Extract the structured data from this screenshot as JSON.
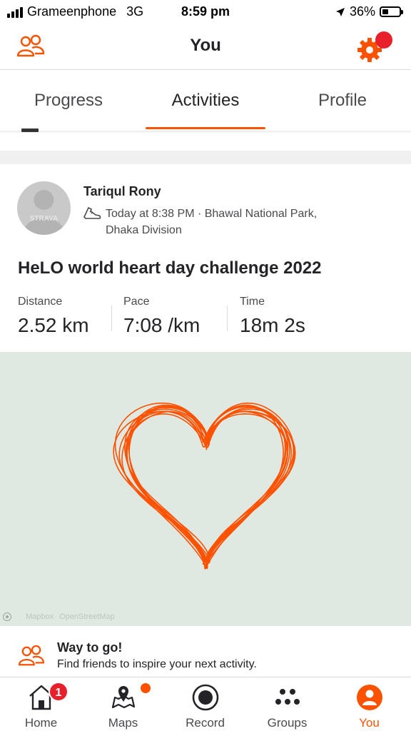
{
  "status_bar": {
    "carrier": "Grameenphone",
    "network": "3G",
    "time": "8:59 pm",
    "battery_percent": "36%",
    "battery_level": 0.36,
    "icons": [
      "signal-bars-icon",
      "location-arrow-icon",
      "battery-icon"
    ]
  },
  "header": {
    "title": "You",
    "left_icon": "friends-icon",
    "right_icon": "gear-icon",
    "accent_color": "#fc5200",
    "notification_color": "#e8202b"
  },
  "tabs": [
    {
      "label": "Progress",
      "active": false
    },
    {
      "label": "Activities",
      "active": true
    },
    {
      "label": "Profile",
      "active": false
    }
  ],
  "activity": {
    "athlete": "Tariqul Rony",
    "avatar_text": "STRAVA",
    "sport_icon": "run-shoe-icon",
    "meta_line1": "Today at 8:38 PM · Bhawal National Park,",
    "meta_line2": "Dhaka Division",
    "title": "HeLO world heart day challenge 2022",
    "stats": [
      {
        "label": "Distance",
        "value": "2.52 km"
      },
      {
        "label": "Pace",
        "value": "7:08 /km"
      },
      {
        "label": "Time",
        "value": "18m 2s"
      }
    ],
    "map": {
      "background_color": "#dfe9e1",
      "route_color": "#fc5200",
      "route_shape": "heart",
      "attribution": [
        "Mapbox",
        "OpenStreetMap"
      ]
    }
  },
  "promo": {
    "icon": "friends-icon",
    "title": "Way to go!",
    "text": "Find friends to inspire your next activity."
  },
  "bottom_nav": [
    {
      "label": "Home",
      "icon": "home-icon",
      "badge": "1",
      "active": false
    },
    {
      "label": "Maps",
      "icon": "map-pin-icon",
      "active": false
    },
    {
      "label": "Record",
      "icon": "record-icon",
      "active": false
    },
    {
      "label": "Groups",
      "icon": "groups-icon",
      "active": false
    },
    {
      "label": "You",
      "icon": "profile-icon",
      "active": true
    }
  ]
}
